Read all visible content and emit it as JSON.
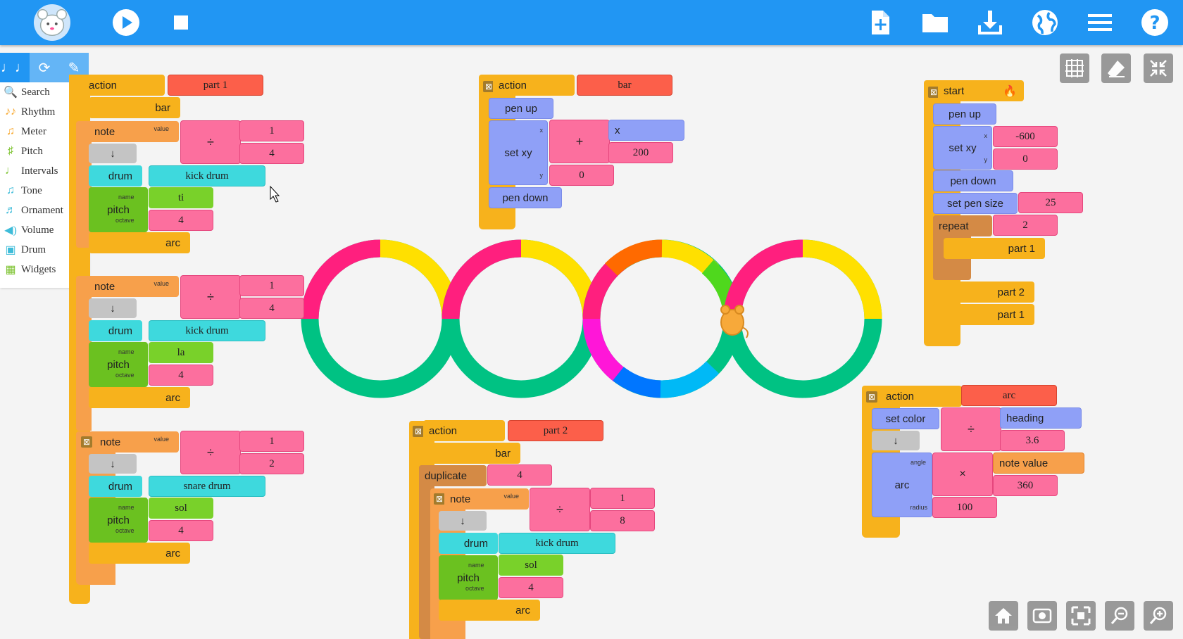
{
  "toolbar": {
    "logo": "mouse-logo",
    "buttons": [
      "play",
      "stop",
      "new-project",
      "load-project",
      "save-project",
      "language",
      "menu",
      "help"
    ]
  },
  "palette": {
    "tabs": [
      "music",
      "flow",
      "art"
    ],
    "items": [
      {
        "label": "Search",
        "icon": "search-icon"
      },
      {
        "label": "Rhythm",
        "icon": "rhythm-icon"
      },
      {
        "label": "Meter",
        "icon": "meter-icon"
      },
      {
        "label": "Pitch",
        "icon": "pitch-icon"
      },
      {
        "label": "Intervals",
        "icon": "intervals-icon"
      },
      {
        "label": "Tone",
        "icon": "tone-icon"
      },
      {
        "label": "Ornament",
        "icon": "ornament-icon"
      },
      {
        "label": "Volume",
        "icon": "volume-icon"
      },
      {
        "label": "Drum",
        "icon": "drum-icon"
      },
      {
        "label": "Widgets",
        "icon": "widgets-icon"
      }
    ]
  },
  "stack_part1": {
    "action": "action",
    "name": "part 1",
    "bar": "bar",
    "notes": [
      {
        "note": "note",
        "value": "value",
        "num": "1",
        "den": "4",
        "down": "↓",
        "drum": "drum",
        "drum_name": "kick drum",
        "pitch": "pitch",
        "name_lbl": "name",
        "octave_lbl": "octave",
        "pitch_name": "ti",
        "octave": "4",
        "arc": "arc"
      },
      {
        "note": "note",
        "value": "value",
        "num": "1",
        "den": "4",
        "down": "↓",
        "drum": "drum",
        "drum_name": "kick drum",
        "pitch": "pitch",
        "name_lbl": "name",
        "octave_lbl": "octave",
        "pitch_name": "la",
        "octave": "4",
        "arc": "arc"
      },
      {
        "note": "note",
        "value": "value",
        "num": "1",
        "den": "2",
        "down": "↓",
        "drum": "drum",
        "drum_name": "snare drum",
        "pitch": "pitch",
        "name_lbl": "name",
        "octave_lbl": "octave",
        "pitch_name": "sol",
        "octave": "4",
        "arc": "arc"
      }
    ]
  },
  "stack_bar": {
    "action": "action",
    "name": "bar",
    "pen_up": "pen up",
    "set_xy": "set xy",
    "x_lbl": "x",
    "y_lbl": "y",
    "plus": "+",
    "x_val": "x",
    "x_add": "200",
    "y_val": "0",
    "pen_down": "pen down"
  },
  "stack_start": {
    "start": "start",
    "pen_up": "pen up",
    "set_xy": "set xy",
    "x_lbl": "x",
    "y_lbl": "y",
    "x_val": "-600",
    "y_val": "0",
    "pen_down": "pen down",
    "set_pen_size": "set pen size",
    "pen_size": "25",
    "repeat": "repeat",
    "repeat_count": "2",
    "part1": "part 1",
    "part2": "part 2",
    "part1b": "part 1"
  },
  "stack_part2": {
    "action": "action",
    "name": "part 2",
    "bar": "bar",
    "duplicate": "duplicate",
    "dup_count": "4",
    "note": "note",
    "value": "value",
    "num": "1",
    "den": "8",
    "down": "↓",
    "drum": "drum",
    "drum_name": "kick drum",
    "pitch": "pitch",
    "name_lbl": "name",
    "octave_lbl": "octave",
    "pitch_name": "sol",
    "octave": "4",
    "arc": "arc"
  },
  "stack_arc": {
    "action": "action",
    "name": "arc",
    "set_color": "set color",
    "heading": "heading",
    "divisor": "3.6",
    "down": "↓",
    "arc": "arc",
    "angle_lbl": "angle",
    "radius_lbl": "radius",
    "times": "×",
    "note_value": "note value",
    "multiplier": "360",
    "radius": "100"
  },
  "colors": {
    "toolbar": "#2196f3",
    "canvas": "#f4f4f4",
    "action": "#f7b21c",
    "number": "#fc6f9e",
    "text": "#fc5f4a",
    "drum": "#3ed9dd",
    "pitch": "#79d12a",
    "pen": "#8fa0f7"
  }
}
